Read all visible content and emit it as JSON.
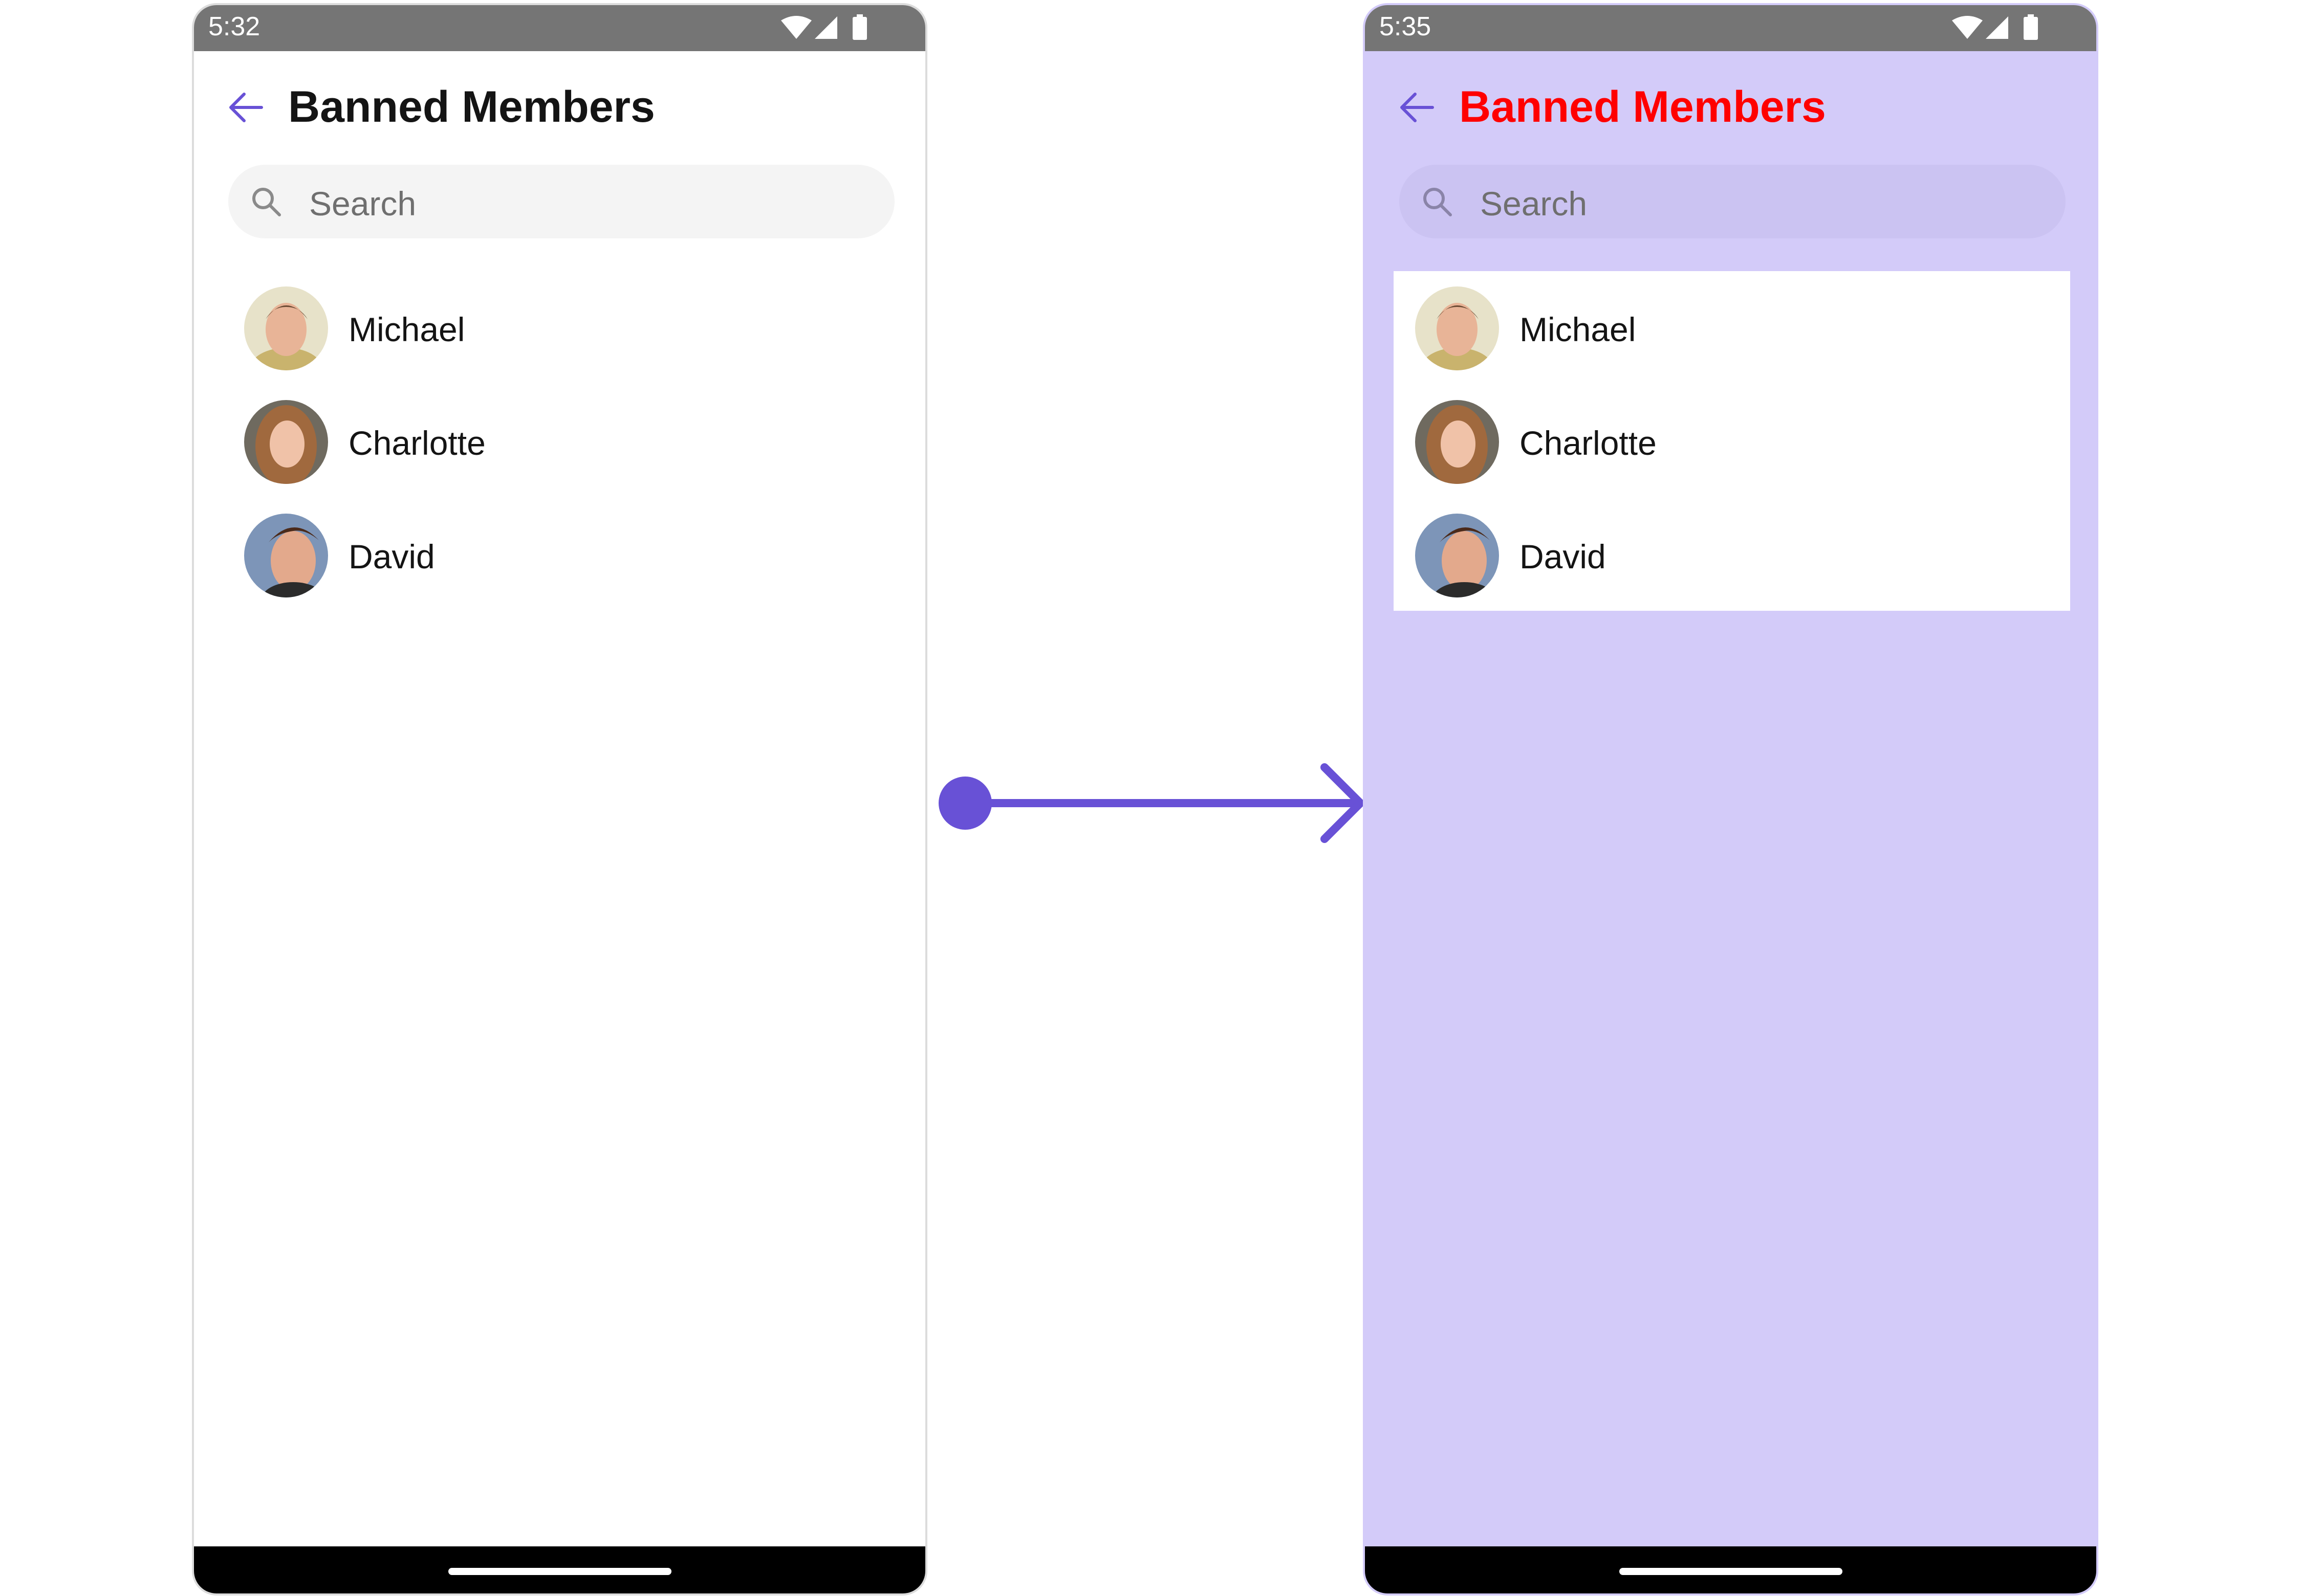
{
  "colors": {
    "accent": "#6851d6",
    "right_background": "#d3cbf9",
    "right_title": "#ff0000",
    "status_bar": "#757575"
  },
  "left_screen": {
    "status": {
      "time": "5:32",
      "icons": [
        "wifi-icon",
        "signal-icon",
        "battery-icon"
      ]
    },
    "header": {
      "back_icon": "arrow-left-icon",
      "title": "Banned Members"
    },
    "search": {
      "icon": "search-icon",
      "placeholder": "Search"
    },
    "members": [
      {
        "name": "Michael"
      },
      {
        "name": "Charlotte"
      },
      {
        "name": "David"
      }
    ]
  },
  "right_screen": {
    "status": {
      "time": "5:35",
      "icons": [
        "wifi-icon",
        "signal-icon",
        "battery-icon"
      ]
    },
    "header": {
      "back_icon": "arrow-left-icon",
      "title": "Banned Members"
    },
    "search": {
      "icon": "search-icon",
      "placeholder": "Search"
    },
    "members": [
      {
        "name": "Michael"
      },
      {
        "name": "Charlotte"
      },
      {
        "name": "David"
      }
    ]
  },
  "transition": {
    "icon": "arrow-right-icon"
  }
}
